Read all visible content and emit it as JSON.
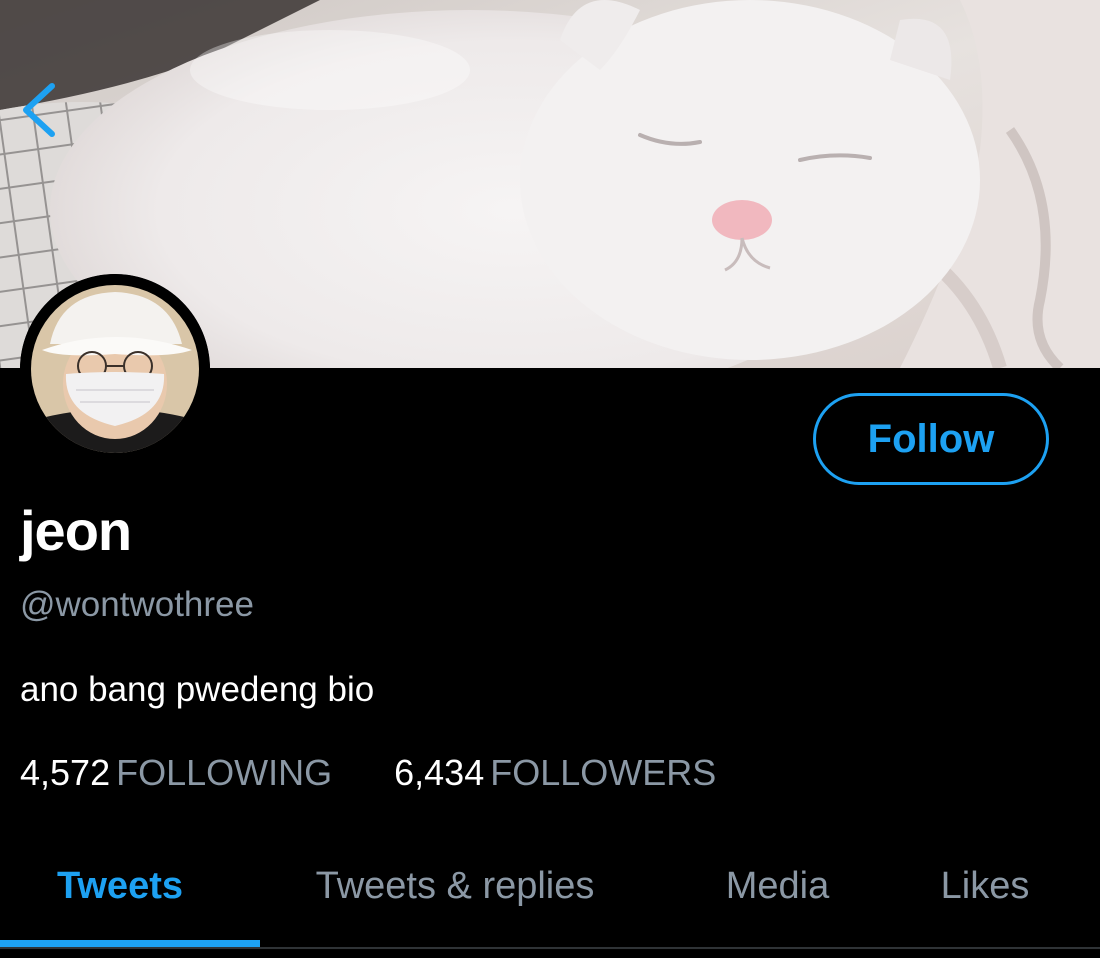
{
  "profile": {
    "display_name": "jeon",
    "handle": "@wontwothree",
    "bio": "ano bang pwedeng bio",
    "follow_label": "Follow",
    "following_count": "4,572",
    "following_label": "FOLLOWING",
    "followers_count": "6,434",
    "followers_label": "FOLLOWERS"
  },
  "tabs": [
    {
      "label": "Tweets",
      "active": true
    },
    {
      "label": "Tweets & replies",
      "active": false
    },
    {
      "label": "Media",
      "active": false
    },
    {
      "label": "Likes",
      "active": false
    }
  ],
  "icons": {
    "back": "chevron-left-icon"
  },
  "colors": {
    "accent": "#1DA1F2",
    "background": "#000000",
    "secondary_text": "#8B98A5"
  }
}
